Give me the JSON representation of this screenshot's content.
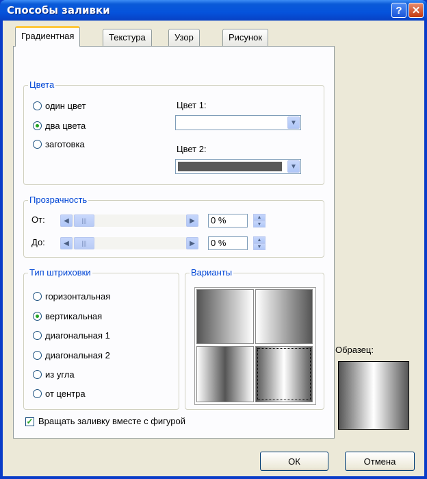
{
  "window": {
    "title": "Способы заливки"
  },
  "titlebar": {
    "help_glyph": "?",
    "close_glyph": "✕"
  },
  "tabs": [
    {
      "label": "Градиентная",
      "active": true
    },
    {
      "label": "Текстура",
      "active": false
    },
    {
      "label": "Узор",
      "active": false
    },
    {
      "label": "Рисунок",
      "active": false
    }
  ],
  "colors_group": {
    "legend": "Цвета",
    "options": [
      "один цвет",
      "два цвета",
      "заготовка"
    ],
    "selected": "два цвета",
    "color1_label": "Цвет 1:",
    "color2_label": "Цвет 2:",
    "color1_value": "#ffffff",
    "color2_value": "#595959"
  },
  "transparency": {
    "legend": "Прозрачность",
    "from_label": "От:",
    "to_label": "До:",
    "from_value": "0 %",
    "to_value": "0 %"
  },
  "hatch": {
    "legend": "Тип штриховки",
    "options": [
      "горизонтальная",
      "вертикальная",
      "диагональная 1",
      "диагональная 2",
      "из угла",
      "от центра"
    ],
    "selected": "вертикальная"
  },
  "variants": {
    "legend": "Варианты"
  },
  "sample": {
    "label": "Образец:"
  },
  "rotate_checkbox": {
    "label": "Вращать заливку вместе с фигурой",
    "checked": true
  },
  "buttons": {
    "ok": "ОК",
    "cancel": "Отмена"
  }
}
